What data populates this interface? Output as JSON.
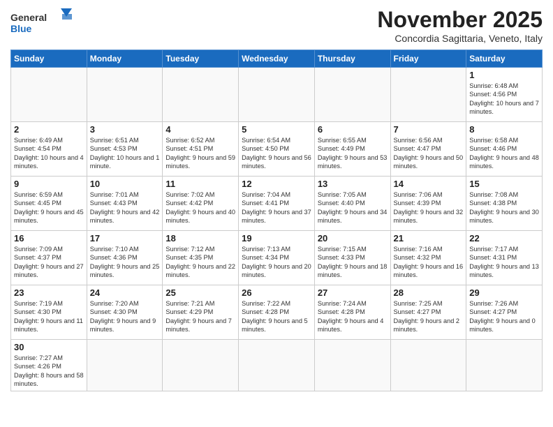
{
  "header": {
    "logo_text_general": "General",
    "logo_text_blue": "Blue",
    "month_title": "November 2025",
    "subtitle": "Concordia Sagittaria, Veneto, Italy"
  },
  "days_of_week": [
    "Sunday",
    "Monday",
    "Tuesday",
    "Wednesday",
    "Thursday",
    "Friday",
    "Saturday"
  ],
  "weeks": [
    [
      {
        "day": "",
        "info": ""
      },
      {
        "day": "",
        "info": ""
      },
      {
        "day": "",
        "info": ""
      },
      {
        "day": "",
        "info": ""
      },
      {
        "day": "",
        "info": ""
      },
      {
        "day": "",
        "info": ""
      },
      {
        "day": "1",
        "info": "Sunrise: 6:48 AM\nSunset: 4:56 PM\nDaylight: 10 hours and 7 minutes."
      }
    ],
    [
      {
        "day": "2",
        "info": "Sunrise: 6:49 AM\nSunset: 4:54 PM\nDaylight: 10 hours and 4 minutes."
      },
      {
        "day": "3",
        "info": "Sunrise: 6:51 AM\nSunset: 4:53 PM\nDaylight: 10 hours and 1 minute."
      },
      {
        "day": "4",
        "info": "Sunrise: 6:52 AM\nSunset: 4:51 PM\nDaylight: 9 hours and 59 minutes."
      },
      {
        "day": "5",
        "info": "Sunrise: 6:54 AM\nSunset: 4:50 PM\nDaylight: 9 hours and 56 minutes."
      },
      {
        "day": "6",
        "info": "Sunrise: 6:55 AM\nSunset: 4:49 PM\nDaylight: 9 hours and 53 minutes."
      },
      {
        "day": "7",
        "info": "Sunrise: 6:56 AM\nSunset: 4:47 PM\nDaylight: 9 hours and 50 minutes."
      },
      {
        "day": "8",
        "info": "Sunrise: 6:58 AM\nSunset: 4:46 PM\nDaylight: 9 hours and 48 minutes."
      }
    ],
    [
      {
        "day": "9",
        "info": "Sunrise: 6:59 AM\nSunset: 4:45 PM\nDaylight: 9 hours and 45 minutes."
      },
      {
        "day": "10",
        "info": "Sunrise: 7:01 AM\nSunset: 4:43 PM\nDaylight: 9 hours and 42 minutes."
      },
      {
        "day": "11",
        "info": "Sunrise: 7:02 AM\nSunset: 4:42 PM\nDaylight: 9 hours and 40 minutes."
      },
      {
        "day": "12",
        "info": "Sunrise: 7:04 AM\nSunset: 4:41 PM\nDaylight: 9 hours and 37 minutes."
      },
      {
        "day": "13",
        "info": "Sunrise: 7:05 AM\nSunset: 4:40 PM\nDaylight: 9 hours and 34 minutes."
      },
      {
        "day": "14",
        "info": "Sunrise: 7:06 AM\nSunset: 4:39 PM\nDaylight: 9 hours and 32 minutes."
      },
      {
        "day": "15",
        "info": "Sunrise: 7:08 AM\nSunset: 4:38 PM\nDaylight: 9 hours and 30 minutes."
      }
    ],
    [
      {
        "day": "16",
        "info": "Sunrise: 7:09 AM\nSunset: 4:37 PM\nDaylight: 9 hours and 27 minutes."
      },
      {
        "day": "17",
        "info": "Sunrise: 7:10 AM\nSunset: 4:36 PM\nDaylight: 9 hours and 25 minutes."
      },
      {
        "day": "18",
        "info": "Sunrise: 7:12 AM\nSunset: 4:35 PM\nDaylight: 9 hours and 22 minutes."
      },
      {
        "day": "19",
        "info": "Sunrise: 7:13 AM\nSunset: 4:34 PM\nDaylight: 9 hours and 20 minutes."
      },
      {
        "day": "20",
        "info": "Sunrise: 7:15 AM\nSunset: 4:33 PM\nDaylight: 9 hours and 18 minutes."
      },
      {
        "day": "21",
        "info": "Sunrise: 7:16 AM\nSunset: 4:32 PM\nDaylight: 9 hours and 16 minutes."
      },
      {
        "day": "22",
        "info": "Sunrise: 7:17 AM\nSunset: 4:31 PM\nDaylight: 9 hours and 13 minutes."
      }
    ],
    [
      {
        "day": "23",
        "info": "Sunrise: 7:19 AM\nSunset: 4:30 PM\nDaylight: 9 hours and 11 minutes."
      },
      {
        "day": "24",
        "info": "Sunrise: 7:20 AM\nSunset: 4:30 PM\nDaylight: 9 hours and 9 minutes."
      },
      {
        "day": "25",
        "info": "Sunrise: 7:21 AM\nSunset: 4:29 PM\nDaylight: 9 hours and 7 minutes."
      },
      {
        "day": "26",
        "info": "Sunrise: 7:22 AM\nSunset: 4:28 PM\nDaylight: 9 hours and 5 minutes."
      },
      {
        "day": "27",
        "info": "Sunrise: 7:24 AM\nSunset: 4:28 PM\nDaylight: 9 hours and 4 minutes."
      },
      {
        "day": "28",
        "info": "Sunrise: 7:25 AM\nSunset: 4:27 PM\nDaylight: 9 hours and 2 minutes."
      },
      {
        "day": "29",
        "info": "Sunrise: 7:26 AM\nSunset: 4:27 PM\nDaylight: 9 hours and 0 minutes."
      }
    ],
    [
      {
        "day": "30",
        "info": "Sunrise: 7:27 AM\nSunset: 4:26 PM\nDaylight: 8 hours and 58 minutes."
      },
      {
        "day": "",
        "info": ""
      },
      {
        "day": "",
        "info": ""
      },
      {
        "day": "",
        "info": ""
      },
      {
        "day": "",
        "info": ""
      },
      {
        "day": "",
        "info": ""
      },
      {
        "day": "",
        "info": ""
      }
    ]
  ]
}
